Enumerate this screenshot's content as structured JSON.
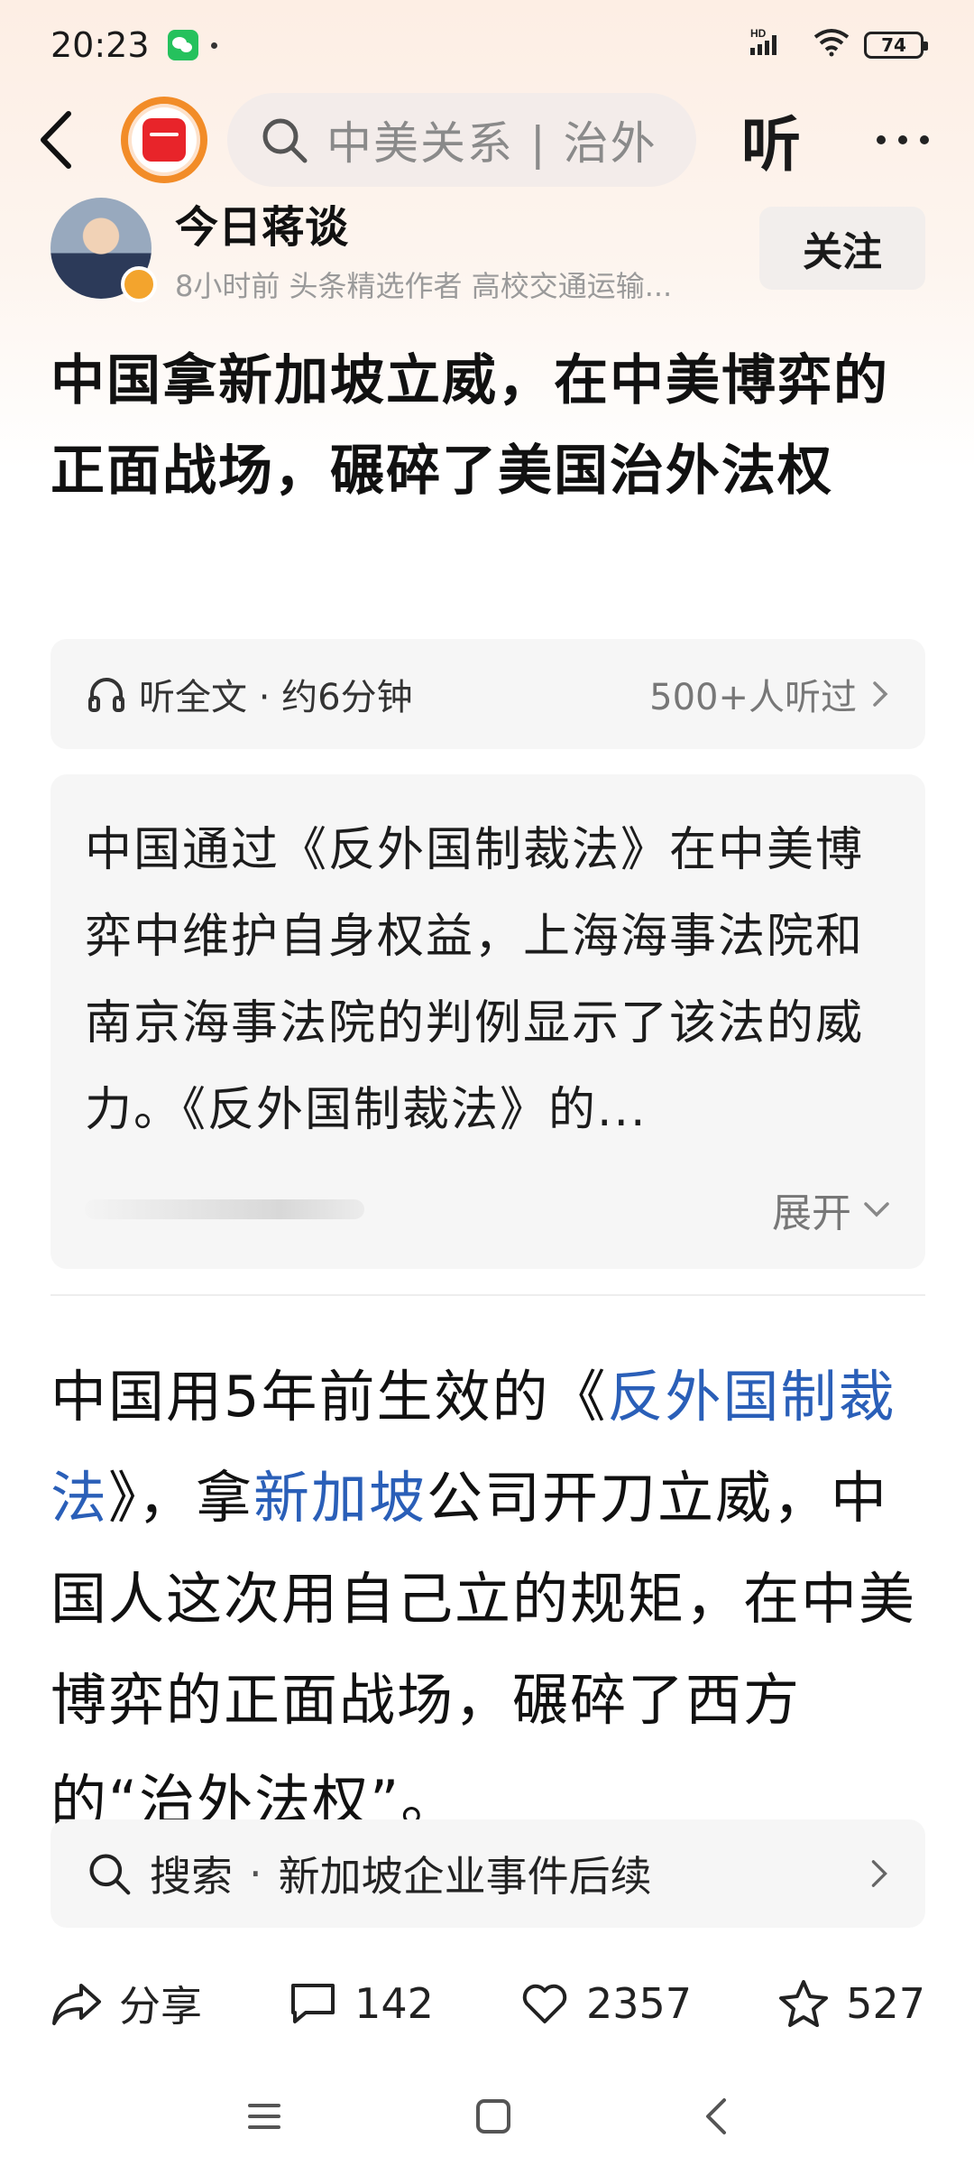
{
  "status_bar": {
    "time": "20:23",
    "signal_label": "HD",
    "battery": "74",
    "icons": [
      "wechat-icon",
      "signal-icon",
      "wifi-icon",
      "battery-icon"
    ]
  },
  "top_nav": {
    "search_text": "中美关系 | 治外",
    "listen_label": "听"
  },
  "author": {
    "name": "今日蒋谈",
    "meta": "8小时前  头条精选作者 高校交通运输...",
    "follow_label": "关注"
  },
  "article": {
    "title": "中国拿新加坡立威，在中美博弈的正面战场，碾碎了美国治外法权",
    "listen_bar": {
      "label": "听全文 · 约6分钟",
      "count": "500+人听过"
    },
    "summary": "中国通过《反外国制裁法》在中美博弈中维护自身权益，上海海事法院和南京海事法院的判例显示了该法的威力。《反外国制裁法》的...",
    "expand_label": "展开",
    "body": {
      "p1_a": "中国用5年前生效的《",
      "p1_link1": "反外国制裁法",
      "p1_b": "》，拿",
      "p1_link2": "新加坡",
      "p1_c": "公司开刀立威，中国人这次用自己立的规矩，在中美博弈的正面战场，碾碎了西方的“治外法权”。"
    }
  },
  "search_suggest": {
    "prefix": "搜索",
    "sep": "·",
    "query": "新加坡企业事件后续"
  },
  "actions": {
    "share": "分享",
    "comments": "142",
    "likes": "2357",
    "favorites": "527"
  },
  "colors": {
    "link": "#2a5fb8",
    "accent": "#e8242a"
  }
}
